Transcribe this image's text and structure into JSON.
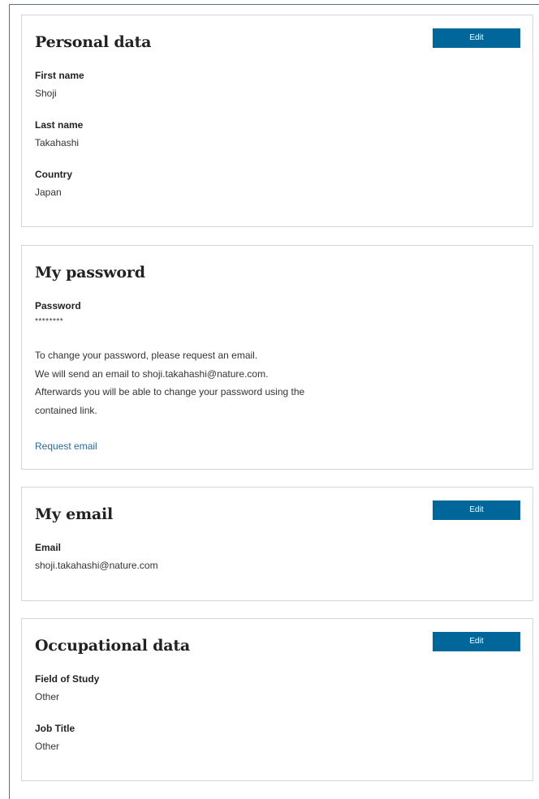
{
  "personal": {
    "title": "Personal data",
    "edit_label": "Edit",
    "fields": [
      {
        "label": "First name",
        "value": "Shoji"
      },
      {
        "label": "Last name",
        "value": "Takahashi"
      },
      {
        "label": "Country",
        "value": "Japan"
      }
    ]
  },
  "password": {
    "title": "My password",
    "label": "Password",
    "value": "********",
    "lines": [
      "To change your password, please request an email.",
      "We will send an email to shoji.takahashi@nature.com.",
      "Afterwards you will be able to change your password using the",
      "contained link."
    ],
    "link": "Request email"
  },
  "email": {
    "title": "My email",
    "edit_label": "Edit",
    "label": "Email",
    "value": "shoji.takahashi@nature.com"
  },
  "occupational": {
    "title": "Occupational data",
    "edit_label": "Edit",
    "fields": [
      {
        "label": "Field of Study",
        "value": "Other"
      },
      {
        "label": "Job Title",
        "value": "Other"
      }
    ]
  }
}
